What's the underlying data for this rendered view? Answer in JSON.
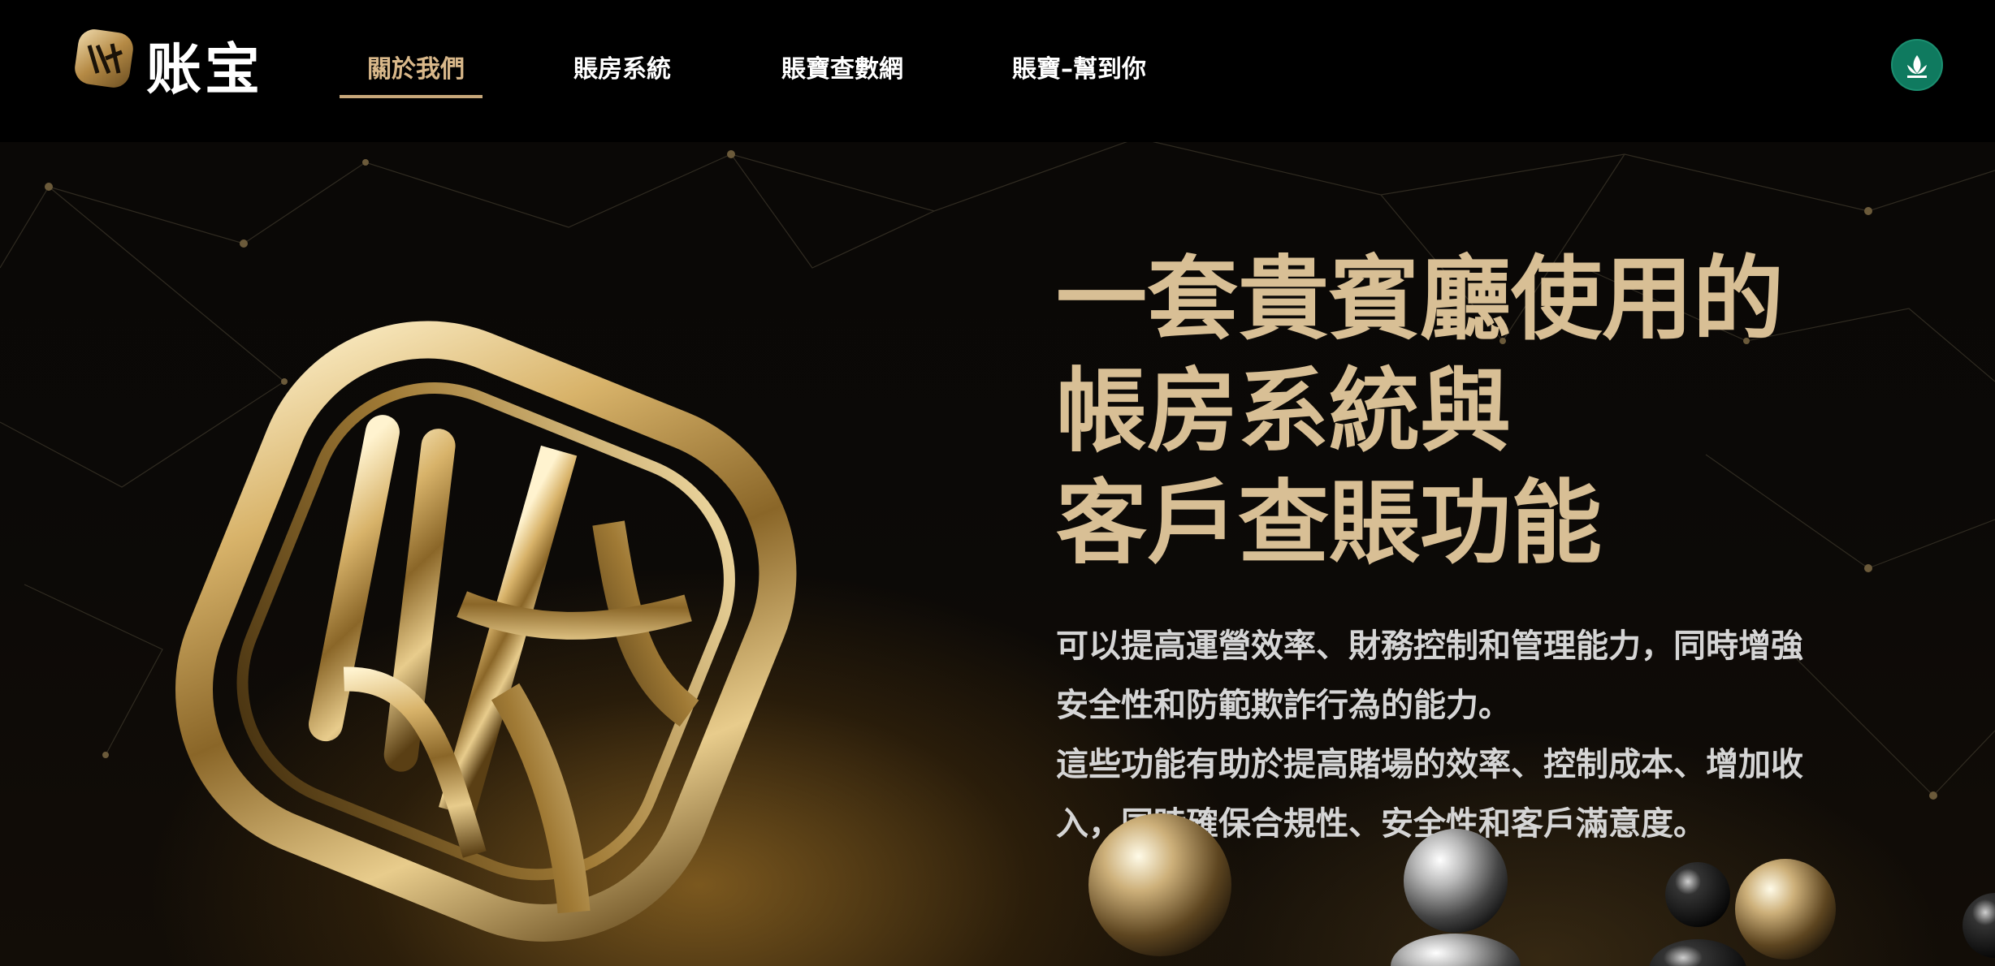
{
  "brand": {
    "logo_text": "账宝",
    "logo_icon": "zhangbao-emblem-icon"
  },
  "nav": {
    "items": [
      {
        "label": "關於我們",
        "active": true
      },
      {
        "label": "賬房系統",
        "active": false
      },
      {
        "label": "賬寶查數網",
        "active": false
      },
      {
        "label": "賬寶–幫到你",
        "active": false
      }
    ],
    "region_icon": "macau-flag-icon"
  },
  "hero": {
    "headline": [
      "一套貴賓廳使用的",
      "帳房系統與",
      "客戶查賬功能"
    ],
    "body_lines": [
      "可以提高運營效率、財務控制和管理能力，同時增強",
      "安全性和防範欺詐行為的能力。",
      "這些功能有助於提高賭場的效率、控制成本、增加收",
      "入，同時確保合規性、安全性和客戶滿意度。"
    ],
    "emblem": "gold-3d-zhangbao-emblem",
    "decoration": "metallic-spheres"
  },
  "colors": {
    "accent_gold": "#d8bf95",
    "nav_active": "#d9b88a",
    "background": "#000000",
    "body_text": "#d5d5d5"
  }
}
